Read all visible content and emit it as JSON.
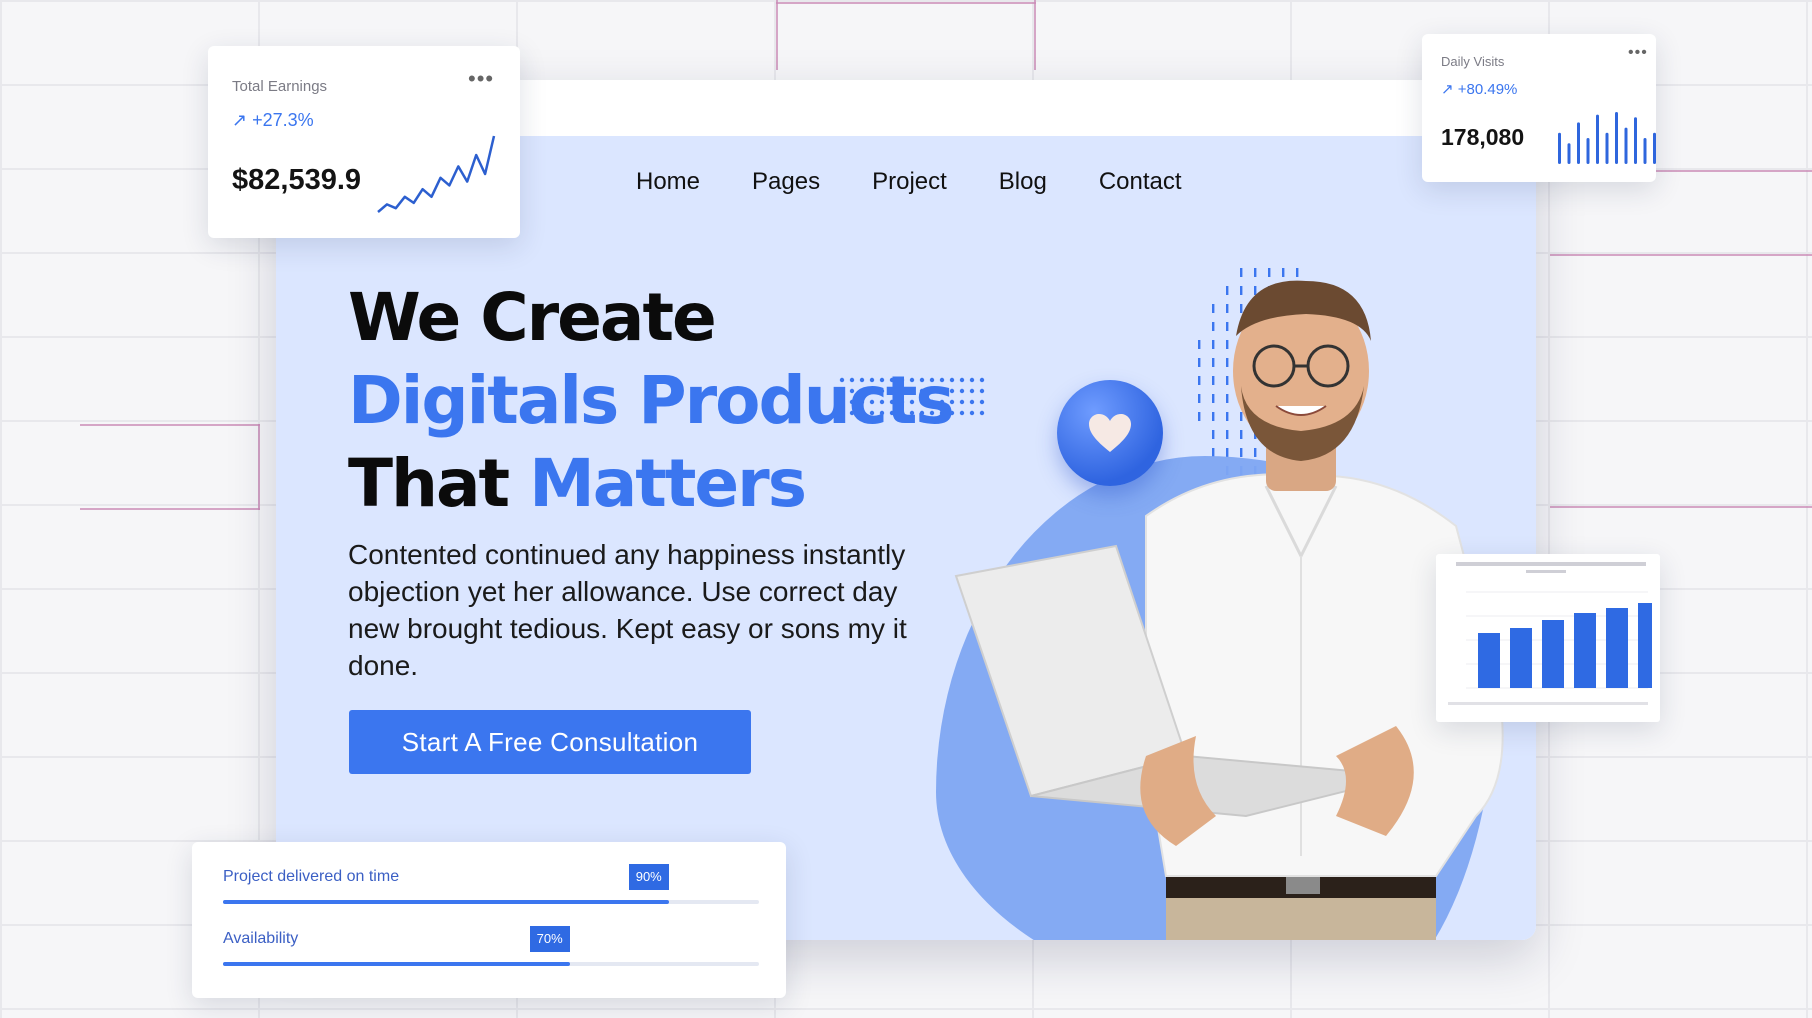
{
  "nav": {
    "items": [
      "Home",
      "Pages",
      "Project",
      "Blog",
      "Contact"
    ]
  },
  "hero": {
    "headline_line1": "We Create",
    "headline_line2": "Digitals Products",
    "headline_line3_dark": "That",
    "headline_line3_blue": "Matters",
    "description": "Contented continued any happiness instantly objection yet her allowance. Use correct day new brought tedious. Kept easy or sons my it done.",
    "cta_label": "Start A Free Consultation"
  },
  "earnings_card": {
    "title": "Total Earnings",
    "change": "+27.3%",
    "value": "$82,539.9",
    "more_icon": "more-dots-icon",
    "trend_icon": "arrow-up-right-icon",
    "sparkline": [
      3,
      4,
      3.5,
      5,
      4.2,
      6,
      5,
      7.5,
      6.5,
      9,
      7,
      10.5,
      8,
      13
    ]
  },
  "visits_card": {
    "title": "Daily Visits",
    "change": "+80.49%",
    "value": "178,080",
    "more_icon": "more-dots-icon",
    "trend_icon": "arrow-up-right-icon",
    "bars": [
      0.6,
      0.4,
      0.8,
      0.5,
      0.95,
      0.6,
      1.0,
      0.7,
      0.9,
      0.5,
      0.6
    ]
  },
  "progress_card": {
    "rows": [
      {
        "label": "Project delivered on time",
        "value": 90,
        "badge": "90%"
      },
      {
        "label": "Availability",
        "value": 70,
        "badge": "70%"
      }
    ]
  },
  "mini_report": {
    "bar_values": [
      0.55,
      0.6,
      0.68,
      0.75,
      0.8,
      0.85
    ]
  },
  "colors": {
    "accent": "#3b76ef",
    "hero_bg": "#dbe6ff",
    "text_dark": "#0b0b0b"
  }
}
